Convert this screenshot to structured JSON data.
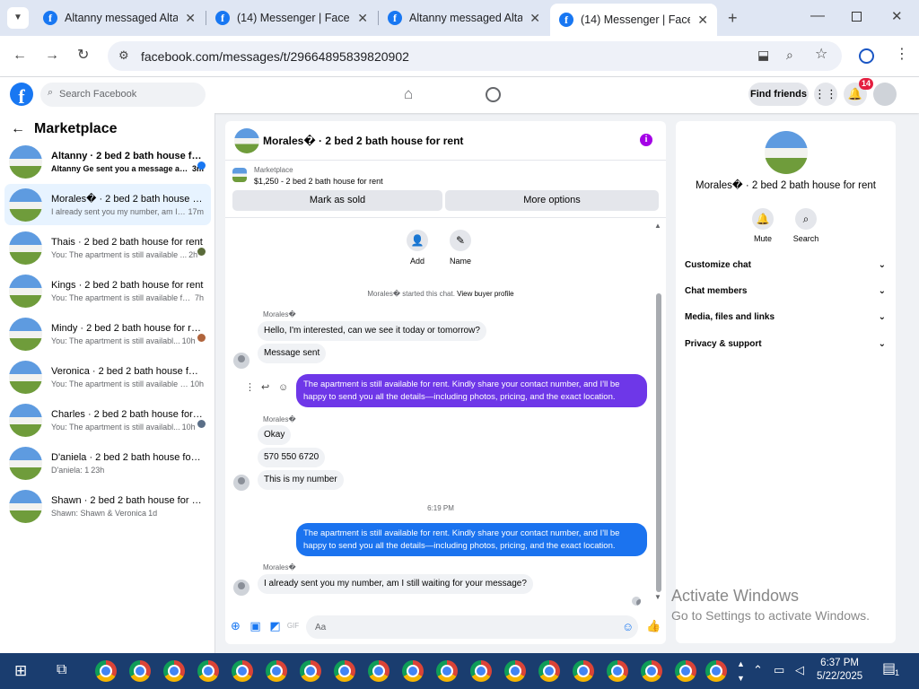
{
  "browser": {
    "tabs": [
      {
        "title": "Altanny messaged Alta"
      },
      {
        "title": "(14) Messenger | Faceb"
      },
      {
        "title": "Altanny messaged Alta"
      },
      {
        "title": "(14) Messenger | Faceb"
      }
    ],
    "url": "facebook.com/messages/t/29664895839820902"
  },
  "fb": {
    "logo_letter": "f",
    "search_placeholder": "Search Facebook",
    "find_friends": "Find friends",
    "notification_count": "14"
  },
  "sidebar": {
    "title": "Marketplace",
    "conversations": [
      {
        "name": "Altanny · 2 bed 2 bath house for rent",
        "preview": "Altanny Ge sent you a message ab...",
        "time": "3m"
      },
      {
        "name": "Morales� · 2 bed 2 bath house for rent",
        "preview": "I already sent you my number, am I ...",
        "time": "17m"
      },
      {
        "name": "Thais · 2 bed 2 bath house for rent",
        "preview": "You: The apartment is still available ...",
        "time": "2h"
      },
      {
        "name": "Kings · 2 bed 2 bath house for rent",
        "preview": "You: The apartment is still available fo...",
        "time": "7h"
      },
      {
        "name": "Mindy · 2 bed 2 bath house for rent",
        "preview": "You: The apartment is still availabl...",
        "time": "10h"
      },
      {
        "name": "Veronica · 2 bed 2 bath house for rent",
        "preview": "You: The apartment is still available f...",
        "time": "10h"
      },
      {
        "name": "Charles · 2 bed 2 bath house for rent",
        "preview": "You: The apartment is still availabl...",
        "time": "10h"
      },
      {
        "name": "D'aniela · 2 bed 2 bath house for rent",
        "preview": "D'aniela: 1",
        "time": "23h"
      },
      {
        "name": "Shawn · 2 bed 2 bath house for rent",
        "preview": "Shawn: Shawn & Veronica",
        "time": "1d"
      }
    ]
  },
  "chat": {
    "title": "Morales� · 2 bed 2 bath house for rent",
    "listing": {
      "category": "Marketplace",
      "price_title": "$1,250 - 2 bed 2 bath house for rent",
      "mark_sold": "Mark as sold",
      "more_options": "More options"
    },
    "actions": {
      "add": "Add",
      "name": "Name"
    },
    "started_text": "Morales� started this chat.",
    "view_profile": "View buyer profile",
    "sender": "Morales�",
    "m1": "Hello, I'm interested, can we see it today or tomorrow?",
    "m2": "Message sent",
    "out1": "The apartment is still available for rent. Kindly share your contact number, and I'll be happy to send you all the details—including photos, pricing, and the exact location.",
    "m3": "Okay",
    "m4": "570 550 6720",
    "m5": "This is my number",
    "time_divider": "6:19 PM",
    "out2": "The apartment is still available for rent. Kindly share your contact number, and I'll be happy to send you all the details—including photos, pricing, and the exact location.",
    "m6": "I already sent you my number, am I still waiting for your message?",
    "compose_placeholder": "Aa"
  },
  "details": {
    "name": "Morales� · 2 bed 2 bath house for rent",
    "mute": "Mute",
    "search": "Search",
    "sections": [
      "Customize chat",
      "Chat members",
      "Media, files and links",
      "Privacy & support"
    ]
  },
  "watermark": {
    "line1": "Activate Windows",
    "line2": "Go to Settings to activate Windows."
  },
  "taskbar": {
    "time": "6:37 PM",
    "date": "5/22/2025",
    "notif_count": "1"
  }
}
